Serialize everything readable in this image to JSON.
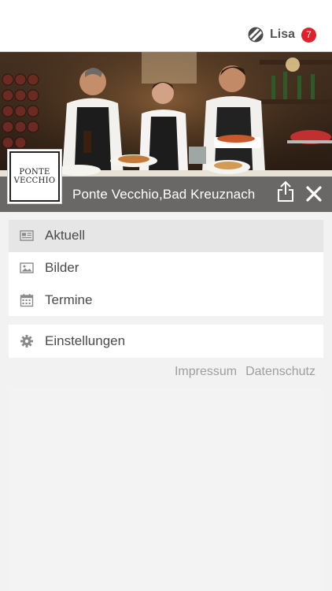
{
  "header": {
    "user_name": "Lisa",
    "notification_count": "7",
    "logo_icon": "globe-stripes-icon"
  },
  "venue": {
    "name": "Ponte Vecchio,Bad Kreuznach",
    "logo_line1": "PONTE",
    "logo_line2": "VECCHIO",
    "share_icon": "share-icon",
    "close_icon": "close-icon"
  },
  "menu": {
    "items": [
      {
        "label": "Aktuell",
        "icon": "newspaper-icon",
        "active": true
      },
      {
        "label": "Bilder",
        "icon": "image-icon",
        "active": false
      },
      {
        "label": "Termine",
        "icon": "calendar-icon",
        "active": false
      }
    ],
    "settings": {
      "label": "Einstellungen",
      "icon": "gear-icon"
    }
  },
  "footer": {
    "impressum": "Impressum",
    "datenschutz": "Datenschutz"
  },
  "colors": {
    "badge": "#e0202a",
    "active_item": "#e6e6e6",
    "hero_bar": "#5f5f5f",
    "link": "#9e9e9e"
  }
}
